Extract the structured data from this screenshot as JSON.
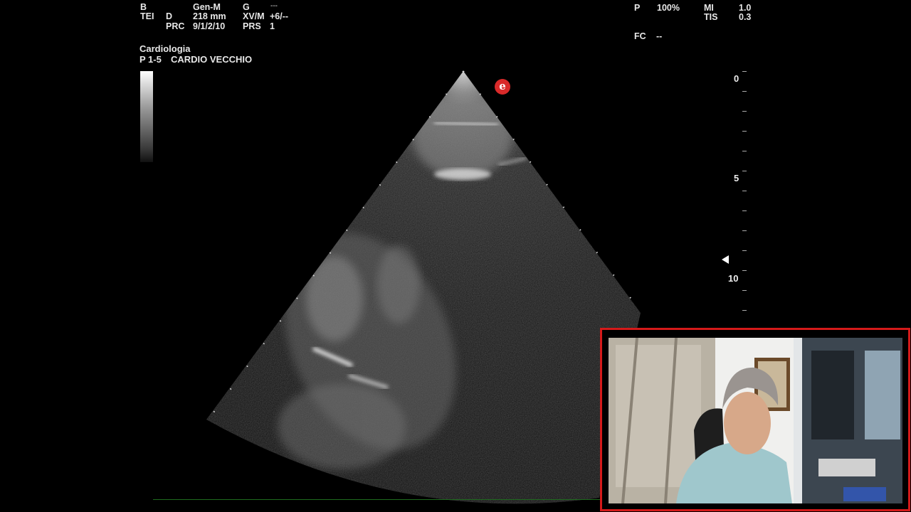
{
  "header_left": {
    "mode": "B",
    "preset": "Gen-M",
    "gain_label": "G",
    "gain_value": "---",
    "tei": "TEI",
    "depth_label": "D",
    "depth_value": "218 mm",
    "xv_label": "XV/M",
    "xv_value": "+6/--",
    "prc_label": "PRC",
    "prc_value": "9/1/2/10",
    "prs_label": "PRS",
    "prs_value": "1"
  },
  "header_right": {
    "power_label": "P",
    "power_value": "100%",
    "mi_label": "MI",
    "mi_value": "1.0",
    "tis_label": "TIS",
    "tis_value": "0.3",
    "fc_label": "FC",
    "fc_value": "--"
  },
  "exam": {
    "department": "Cardiologia",
    "probe": "P 1-5",
    "preset_name": "CARDIO VECCHIO"
  },
  "depth_scale": {
    "labels": [
      "0",
      "5",
      "10"
    ]
  },
  "orientation_marker": "e",
  "colors": {
    "webcam_border": "#d51a1a",
    "marker": "#d92a2a",
    "baseline": "#1e6a1e"
  }
}
